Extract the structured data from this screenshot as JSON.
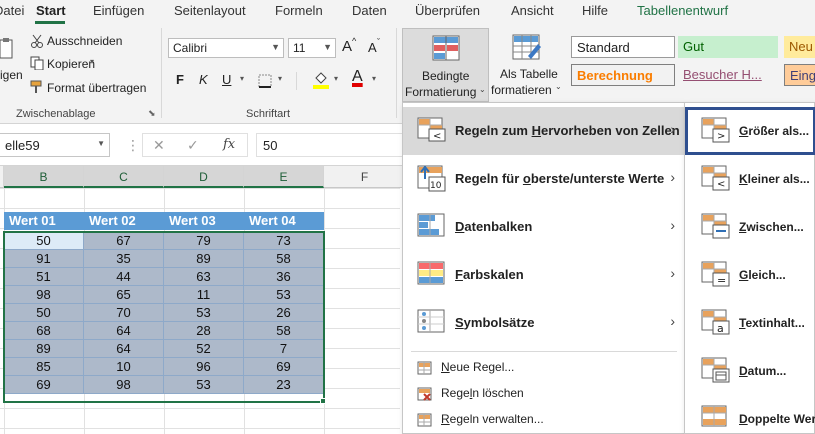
{
  "tabs": [
    "Datei",
    "Start",
    "Einfügen",
    "Seitenlayout",
    "Formeln",
    "Daten",
    "Überprüfen",
    "Ansicht",
    "Hilfe",
    "Tabellenentwurf"
  ],
  "clipboard": {
    "paste_label": "igen",
    "cut": "Ausschneiden",
    "copy": "Kopieren",
    "format_painter": "Format übertragen",
    "group_label": "Zwischenablage"
  },
  "font": {
    "family": "Calibri",
    "size": "11",
    "bold": "F",
    "italic": "K",
    "underline": "U",
    "grow": "A",
    "shrink": "A",
    "font_color": "A",
    "group_label": "Schriftart"
  },
  "styles": {
    "conditional_formatting_line1": "Bedingte",
    "conditional_formatting_line2": "Formatierung",
    "format_as_table_line1": "Als Tabelle",
    "format_as_table_line2": "formatieren",
    "standard": "Standard",
    "gut": "Gut",
    "neutral": "Neu",
    "berechnung": "Berechnung",
    "besucher": "Besucher H...",
    "eingabe": "Eing"
  },
  "formula_bar": {
    "name_box": "elle59",
    "fx": "fx",
    "value": "50"
  },
  "grid": {
    "columns": [
      "B",
      "C",
      "D",
      "E",
      "F"
    ],
    "headers": [
      "Wert 01",
      "Wert 02",
      "Wert 03",
      "Wert 04"
    ],
    "rows": [
      [
        "50",
        "67",
        "79",
        "73"
      ],
      [
        "91",
        "35",
        "89",
        "58"
      ],
      [
        "51",
        "44",
        "63",
        "36"
      ],
      [
        "98",
        "65",
        "11",
        "53"
      ],
      [
        "50",
        "70",
        "53",
        "26"
      ],
      [
        "68",
        "64",
        "28",
        "58"
      ],
      [
        "89",
        "64",
        "52",
        "7"
      ],
      [
        "85",
        "10",
        "96",
        "69"
      ],
      [
        "69",
        "98",
        "53",
        "23"
      ]
    ]
  },
  "menu": {
    "highlight_rules": "Regeln zum Hervorheben von Zellen",
    "top_bottom": "Regeln für oberste/unterste Werte",
    "data_bars": "Datenbalken",
    "color_scales": "Farbskalen",
    "icon_sets": "Symbolsätze",
    "new_rule": "Neue Regel...",
    "clear_rules": "Regeln löschen",
    "manage_rules": "Regeln verwalten..."
  },
  "submenu": {
    "greater": "Größer als...",
    "less": "Kleiner als...",
    "between": "Zwischen...",
    "equal": "Gleich...",
    "text_contains": "Textinhalt...",
    "date": "Datum...",
    "duplicate": "Doppelte Wer"
  },
  "colors": {
    "accent": "#217346",
    "table_header": "#5b9bd5",
    "table_cell": "#adb9ca",
    "highlight_border": "#2f4f8f"
  }
}
